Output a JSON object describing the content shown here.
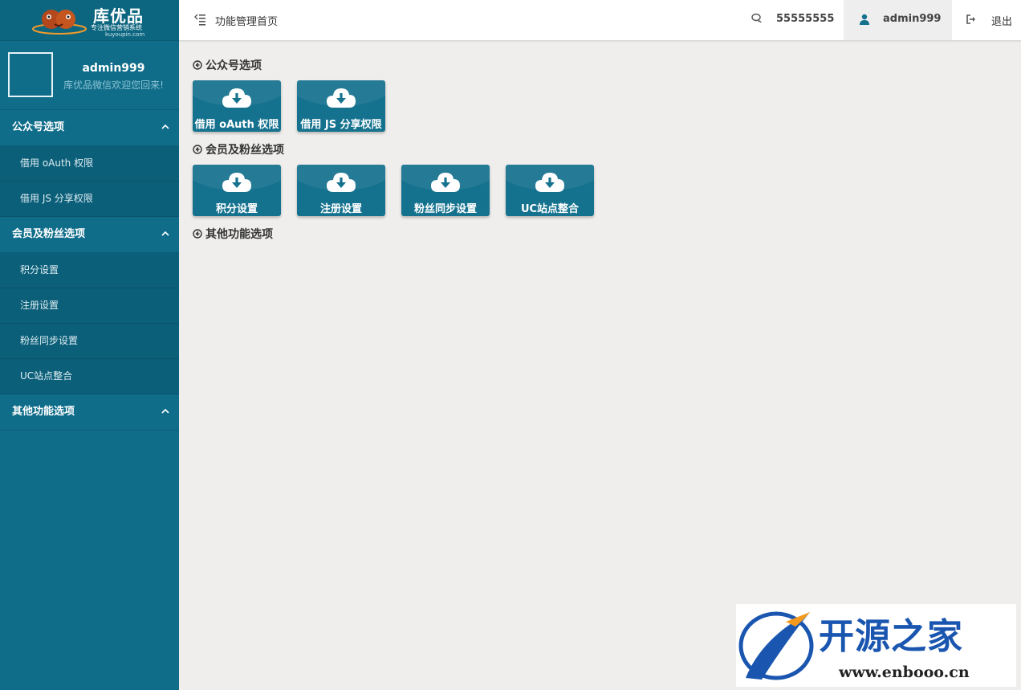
{
  "logo": {
    "brand": "库优品",
    "slogan": "专注微信营销系统",
    "url": "kuyoupin.com"
  },
  "user": {
    "name": "admin999",
    "welcome": "库优品微信欢迎您回来!"
  },
  "sidebar": {
    "groups": [
      {
        "label": "公众号选项",
        "items": [
          "借用 oAuth 权限",
          "借用 JS 分享权限"
        ]
      },
      {
        "label": "会员及粉丝选项",
        "items": [
          "积分设置",
          "注册设置",
          "粉丝同步设置",
          "UC站点整合"
        ]
      },
      {
        "label": "其他功能选项",
        "items": []
      }
    ]
  },
  "topbar": {
    "title": "功能管理首页",
    "number": "55555555",
    "admin": "admin999",
    "logout": "退出"
  },
  "main": {
    "sections": [
      {
        "title": "公众号选项",
        "tiles": [
          "借用 oAuth 权限",
          "借用 JS 分享权限"
        ]
      },
      {
        "title": "会员及粉丝选项",
        "tiles": [
          "积分设置",
          "注册设置",
          "粉丝同步设置",
          "UC站点整合"
        ]
      },
      {
        "title": "其他功能选项",
        "tiles": []
      }
    ]
  },
  "watermark": {
    "name": "开源之家",
    "url": "www.enbooo.cn"
  },
  "colors": {
    "sidebar": "#0f6d8a",
    "sidebar_sub": "#0c5f79",
    "tile": "#15728f",
    "background": "#efeeec"
  }
}
